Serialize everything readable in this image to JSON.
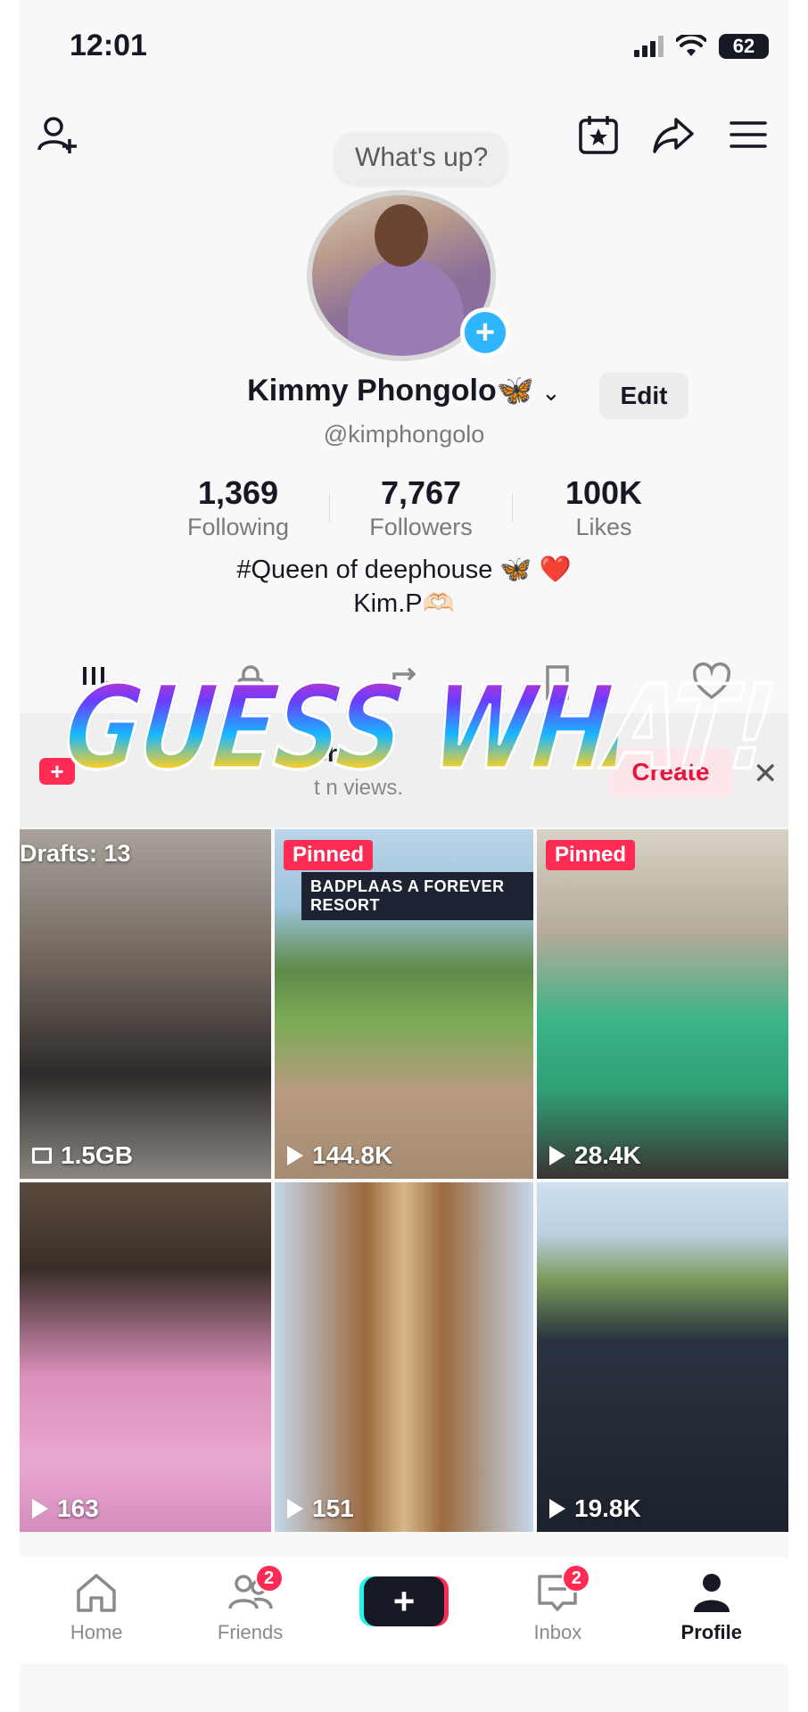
{
  "status": {
    "time": "12:01",
    "battery": "62"
  },
  "bubble": "What's up?",
  "profile": {
    "name": "Kimmy Phongolo🦋",
    "handle": "@kimphongolo",
    "edit_label": "Edit",
    "bio_line1": "#Queen of deephouse 🦋 ❤️",
    "bio_line2": "Kim.P🫶🏻"
  },
  "stats": [
    {
      "value": "1,369",
      "label": "Following"
    },
    {
      "value": "7,767",
      "label": "Followers"
    },
    {
      "value": "100K",
      "label": "Likes"
    }
  ],
  "banner": {
    "title_partial": "ch",
    "subtitle_partial": "t n   views.",
    "create_label": "Create"
  },
  "overlay_text": "GUESS WHAT!",
  "videos": [
    {
      "badge": "Drafts: 13",
      "meta": "1.5GB",
      "meta_icon": "folder-icon"
    },
    {
      "badge": "Pinned",
      "meta": "144.8K",
      "caption": "BADPLAAS A FOREVER RESORT",
      "meta_icon": "play-icon"
    },
    {
      "badge": "Pinned",
      "meta": "28.4K",
      "meta_icon": "play-icon"
    },
    {
      "badge": "",
      "meta": "163",
      "meta_icon": "play-icon"
    },
    {
      "badge": "",
      "meta": "151",
      "meta_icon": "play-icon"
    },
    {
      "badge": "",
      "meta": "19.8K",
      "meta_icon": "play-icon"
    }
  ],
  "nav": [
    {
      "label": "Home"
    },
    {
      "label": "Friends",
      "badge": "2"
    },
    {
      "label": ""
    },
    {
      "label": "Inbox",
      "badge": "2"
    },
    {
      "label": "Profile"
    }
  ],
  "colors": {
    "accent": "#fe2c55",
    "plus_blue": "#2fb4ff"
  }
}
